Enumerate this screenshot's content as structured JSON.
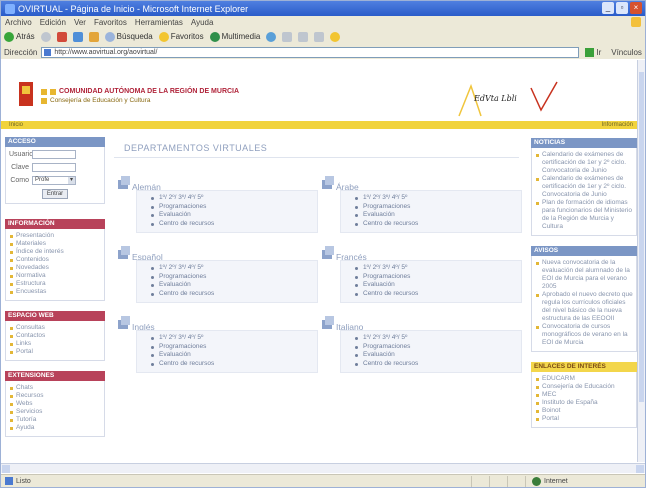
{
  "window": {
    "title": "OVIRTUAL - Página de Inicio - Microsoft Internet Explorer",
    "controls": [
      "_",
      "▫",
      "×"
    ]
  },
  "menubar": {
    "items": [
      "Archivo",
      "Edición",
      "Ver",
      "Favoritos",
      "Herramientas",
      "Ayuda"
    ]
  },
  "toolbar": {
    "back": "Atrás",
    "search": "Búsqueda",
    "favorites": "Favoritos",
    "multimedia": "Multimedia"
  },
  "address": {
    "label": "Dirección",
    "url": "http://www.aovirtual.org/aovirtual/",
    "go": "Ir",
    "links": "Vínculos"
  },
  "banner": {
    "org": "COMUNIDAD AUTÓNOMA DE LA REGIÓN DE MURCIA",
    "dept": "Consejería de Educación y Cultura",
    "logo_text": "EdVta Lbli"
  },
  "yellowbar": {
    "left": "Inicio",
    "right": "Información"
  },
  "left": {
    "access": {
      "title": "ACCESO",
      "user_label": "Usuario",
      "pass_label": "Clave",
      "as_label": "Como",
      "as_value": "Profe",
      "enter": "Entrar"
    },
    "info": {
      "title": "INFORMACIÓN",
      "items": [
        "Presentación",
        "Materiales",
        "Índice de interés",
        "Contenidos",
        "Novedades",
        "Normativa",
        "Estructura",
        "Encuestas"
      ]
    },
    "web": {
      "title": "ESPACIO WEB",
      "items": [
        "Consultas",
        "Contactos",
        "Links",
        "Portal"
      ]
    },
    "ext": {
      "title": "EXTENSIONES",
      "items": [
        "Chats",
        "Recursos",
        "Webs",
        "Servicios",
        "Tutoría",
        "Ayuda"
      ]
    }
  },
  "center": {
    "title": "DEPARTAMENTOS VIRTUALES",
    "item_labels": [
      "1º/ 2º/ 3º/ 4º/ 5º",
      "Programaciones",
      "Evaluación",
      "Centro de recursos"
    ],
    "departments": [
      {
        "name": "Alemán"
      },
      {
        "name": "Árabe"
      },
      {
        "name": "Español"
      },
      {
        "name": "Francés"
      },
      {
        "name": "Inglés"
      },
      {
        "name": "Italiano"
      }
    ]
  },
  "right": {
    "news": {
      "title": "NOTICIAS",
      "items": [
        "Calendario de exámenes de certificación de 1er y 2º ciclo. Convocatoria de Junio",
        "Calendario de exámenes de certificación de 1er y 2º ciclo. Convocatoria de Junio",
        "Plan de formación de idiomas para funcionarios del Ministerio de la Región de Murcia y Cultura"
      ]
    },
    "notices": {
      "title": "AVISOS",
      "items": [
        "Nueva convocatoria de la evaluación del alumnado de la EOI de Murcia para el verano 2005",
        "Aprobado el nuevo decreto que regula los currículos oficiales del nivel básico de la nueva estructura de las EEOOII",
        "Convocatoria de cursos monográficos de verano en la EOI de Murcia"
      ]
    },
    "links": {
      "title": "ENLACES DE INTERÉS",
      "items": [
        "EDUCARM",
        "Consejería de Educación",
        "MEC",
        "Instituto de España",
        "Boinot",
        "Portal"
      ]
    }
  },
  "status": {
    "left": "Listo",
    "zone": "Internet"
  }
}
